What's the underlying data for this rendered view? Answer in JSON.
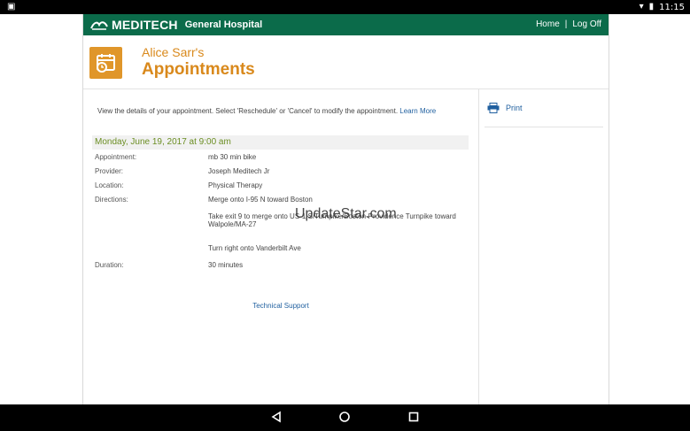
{
  "status_bar": {
    "notification_icon": "notification-icon",
    "wifi_icon": "wifi-icon",
    "battery_icon": "battery-icon",
    "time": "11:15"
  },
  "header": {
    "brand_name": "MEDITECH",
    "brand_sub": "General Hospital",
    "home_link": "Home",
    "separator": "|",
    "logoff_link": "Log Off",
    "colors": {
      "bar": "#0b6b4a",
      "accent": "#d9891c"
    }
  },
  "page": {
    "owner": "Alice Sarr's",
    "title": "Appointments",
    "calendar_icon": "calendar-clock-icon"
  },
  "intro": {
    "text": "View the details of your appointment. Select 'Reschedule' or 'Cancel' to modify the appointment.",
    "link": "Learn More"
  },
  "appointment": {
    "date_line": "Monday, June 19, 2017 at 9:00 am",
    "rows": {
      "appointment": {
        "label": "Appointment:",
        "value": "mb 30 min bike"
      },
      "provider": {
        "label": "Provider:",
        "value": "Joseph Meditech Jr"
      },
      "location": {
        "label": "Location:",
        "value": "Physical Therapy"
      },
      "directions": {
        "label": "Directions:",
        "steps": [
          "Merge onto I-95 N toward Boston",
          "Take exit 9 to merge onto US-1 S/Turnpike/Boston-Providence Turnpike toward Walpole/MA-27",
          "Turn right onto Vanderbilt Ave"
        ]
      },
      "duration": {
        "label": "Duration:",
        "value": "30 minutes"
      }
    },
    "tech_support": "Technical Support"
  },
  "side": {
    "print_label": "Print",
    "print_icon": "printer-icon"
  },
  "watermark": "UpdateStar.com",
  "nav": {
    "back_icon": "back-icon",
    "home_icon": "home-icon",
    "recents_icon": "recents-icon"
  }
}
